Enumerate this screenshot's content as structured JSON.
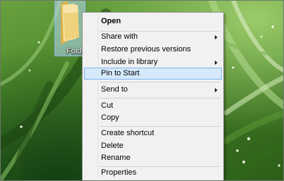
{
  "desktop": {
    "folder_icon_label": "Folde"
  },
  "context_menu": {
    "items": [
      {
        "label": "Open",
        "bold": true
      },
      {
        "label": "Share with",
        "submenu": true
      },
      {
        "label": "Restore previous versions"
      },
      {
        "label": "Include in library",
        "submenu": true
      },
      {
        "label": "Pin to Start",
        "highlighted": true
      },
      {
        "label": "Send to",
        "submenu": true
      },
      {
        "label": "Cut"
      },
      {
        "label": "Copy"
      },
      {
        "label": "Create shortcut"
      },
      {
        "label": "Delete"
      },
      {
        "label": "Rename"
      },
      {
        "label": "Properties"
      }
    ]
  },
  "colors": {
    "menu_background": "#f1f1f1",
    "highlight_fill": "#d5e9fb",
    "highlight_border": "#7eb4ea",
    "selection_fill": "#b4d7f5"
  }
}
